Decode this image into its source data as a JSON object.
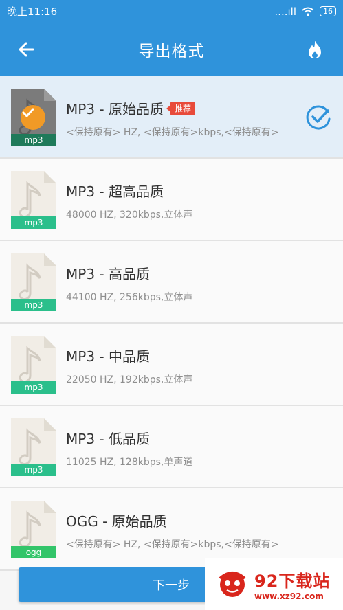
{
  "status_bar": {
    "time": "晚上11:16",
    "signal": "....ıll",
    "battery": "16"
  },
  "header": {
    "title": "导出格式",
    "back_icon": "arrow-left-icon",
    "action_icon": "flame-icon"
  },
  "colors": {
    "primary": "#2f93db",
    "mp3_label": "#2bbf8b",
    "ogg_label": "#33c56a",
    "selected_mp3_label": "#1f7a5a",
    "badge": "#f19a26",
    "tag": "#e84a3a"
  },
  "formats": [
    {
      "name": "MP3 - 原始品质",
      "detail": "<保持原有> HZ, <保持原有>kbps,<保持原有>",
      "ext": "mp3",
      "tag": "推荐",
      "selected": true
    },
    {
      "name": "MP3 - 超高品质",
      "detail": "48000 HZ, 320kbps,立体声",
      "ext": "mp3"
    },
    {
      "name": "MP3 - 高品质",
      "detail": "44100 HZ, 256kbps,立体声",
      "ext": "mp3"
    },
    {
      "name": "MP3 - 中品质",
      "detail": "22050 HZ, 192kbps,立体声",
      "ext": "mp3"
    },
    {
      "name": "MP3 - 低品质",
      "detail": "11025 HZ, 128kbps,单声道",
      "ext": "mp3"
    },
    {
      "name": "OGG - 原始品质",
      "detail": "<保持原有> HZ, <保持原有>kbps,<保持原有>",
      "ext": "ogg"
    }
  ],
  "footer": {
    "next_label": "下一步"
  },
  "watermark": {
    "main": "92下载站",
    "url": "www.xz92.com"
  }
}
